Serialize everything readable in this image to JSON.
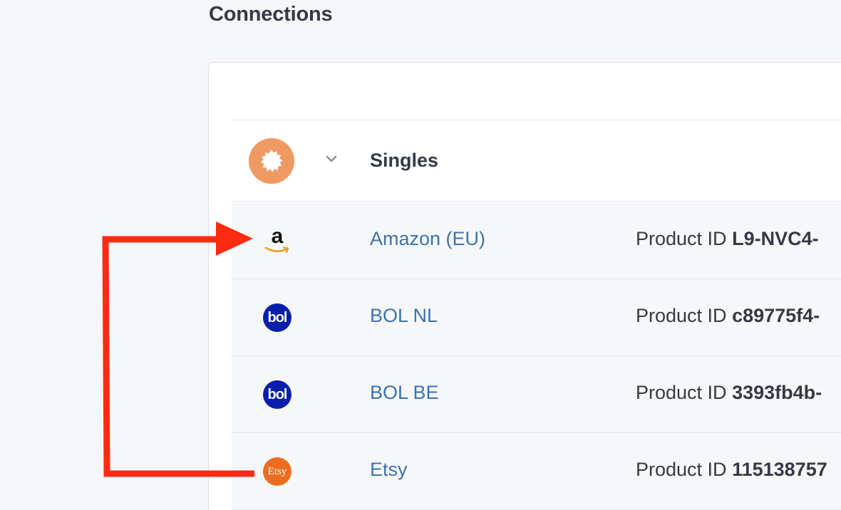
{
  "section": {
    "title": "Connections"
  },
  "group": {
    "name": "Singles",
    "avatar_color": "#ef9a63",
    "avatar_icon": "badge-seal-icon"
  },
  "rows": [
    {
      "name": "Amazon (EU)",
      "icon": "amazon-logo-icon",
      "meta_label": "Product ID",
      "meta_value": "L9-NVC4-"
    },
    {
      "name": "BOL NL",
      "icon": "bol-logo-icon",
      "icon_text": "bol",
      "meta_label": "Product ID",
      "meta_value": "c89775f4-"
    },
    {
      "name": "BOL BE",
      "icon": "bol-logo-icon",
      "icon_text": "bol",
      "meta_label": "Product ID",
      "meta_value": "3393fb4b-"
    },
    {
      "name": "Etsy",
      "icon": "etsy-logo-icon",
      "icon_text": "Etsy",
      "meta_label": "Product ID",
      "meta_value": "115138757"
    }
  ],
  "colors": {
    "link": "#3b73b0",
    "annotation_arrow": "#ff2a12",
    "bol_brand": "#0a1eac",
    "etsy_brand": "#eb6d20"
  }
}
